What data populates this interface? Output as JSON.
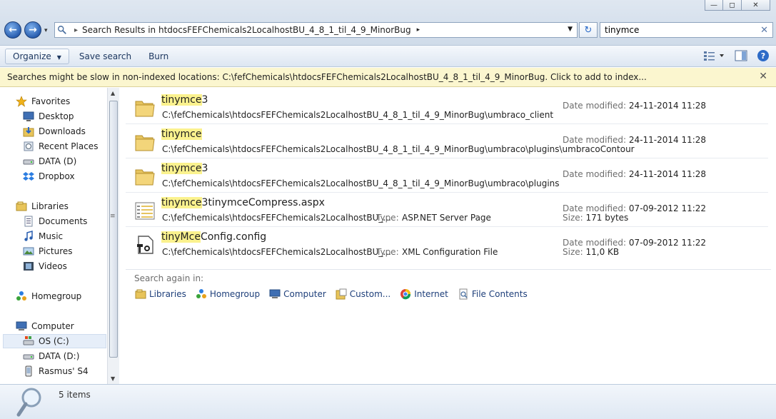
{
  "window": {
    "minimize": "—",
    "maximize": "◻",
    "close": "✕"
  },
  "nav": {
    "back": "←",
    "forward": "→",
    "dropdown": "▾"
  },
  "address": {
    "path_label": "Search Results in htdocsFEFChemicals2LocalhostBU_4_8_1_til_4_9_MinorBug"
  },
  "search": {
    "value": "tinymce",
    "clear": "✕"
  },
  "toolbar": {
    "organize": "Organize",
    "save_search": "Save search",
    "burn": "Burn"
  },
  "infobar": {
    "text": "Searches might be slow in non-indexed locations: C:\\fefChemicals\\htdocsFEFChemicals2LocalhostBU_4_8_1_til_4_9_MinorBug. Click to add to index...",
    "close": "✕"
  },
  "sidebar": {
    "items": [
      {
        "label": "Favorites",
        "icon": "star-icon"
      },
      {
        "label": "Desktop",
        "icon": "desktop-icon"
      },
      {
        "label": "Downloads",
        "icon": "downloads-icon"
      },
      {
        "label": "Recent Places",
        "icon": "recent-places-icon"
      },
      {
        "label": "DATA (D)",
        "icon": "drive-icon"
      },
      {
        "label": "Dropbox",
        "icon": "dropbox-icon"
      },
      {
        "label": "Libraries",
        "icon": "libraries-icon"
      },
      {
        "label": "Documents",
        "icon": "documents-icon"
      },
      {
        "label": "Music",
        "icon": "music-icon"
      },
      {
        "label": "Pictures",
        "icon": "pictures-icon"
      },
      {
        "label": "Videos",
        "icon": "videos-icon"
      },
      {
        "label": "Homegroup",
        "icon": "homegroup-icon"
      },
      {
        "label": "Computer",
        "icon": "computer-icon"
      },
      {
        "label": "OS (C:)",
        "icon": "os-drive-icon"
      },
      {
        "label": "DATA (D:)",
        "icon": "drive-icon"
      },
      {
        "label": "Rasmus' S4",
        "icon": "phone-icon"
      }
    ]
  },
  "results": [
    {
      "hl": "tinymce",
      "rest": "3",
      "path": "C:\\fefChemicals\\htdocsFEFChemicals2LocalhostBU_4_8_1_til_4_9_MinorBug\\umbraco_client",
      "type_label": "",
      "type_value": "",
      "m1_label": "Date modified:",
      "m1_value": "24-11-2014 11:28",
      "m2_label": "",
      "m2_value": "",
      "icon": "folder-icon"
    },
    {
      "hl": "tinymce",
      "rest": "",
      "path": "C:\\fefChemicals\\htdocsFEFChemicals2LocalhostBU_4_8_1_til_4_9_MinorBug\\umbraco\\plugins\\umbracoContour",
      "type_label": "",
      "type_value": "",
      "m1_label": "",
      "m1_value": "",
      "m2_label": "Date modified:",
      "m2_value": "24-11-2014 11:28",
      "icon": "folder-icon"
    },
    {
      "hl": "tinymce",
      "rest": "3",
      "path": "C:\\fefChemicals\\htdocsFEFChemicals2LocalhostBU_4_8_1_til_4_9_MinorBug\\umbraco\\plugins",
      "type_label": "",
      "type_value": "",
      "m1_label": "",
      "m1_value": "",
      "m2_label": "Date modified:",
      "m2_value": "24-11-2014 11:28",
      "icon": "folder-icon"
    },
    {
      "hl": "tinymce",
      "rest": "3tinymceCompress.aspx",
      "path": "C:\\fefChemicals\\htdocsFEFChemicals2LocalhostBU_...",
      "type_label": "Type:",
      "type_value": "ASP.NET Server Page",
      "m1_label": "Date modified:",
      "m1_value": "07-09-2012 11:22",
      "m2_label": "Size:",
      "m2_value": "171 bytes",
      "icon": "aspx-file-icon"
    },
    {
      "hl": "tinyMce",
      "rest": "Config.config",
      "path": "C:\\fefChemicals\\htdocsFEFChemicals2LocalhostBU_...",
      "type_label": "Type:",
      "type_value": "XML Configuration File",
      "m1_label": "Date modified:",
      "m1_value": "07-09-2012 11:22",
      "m2_label": "Size:",
      "m2_value": "11,0 KB",
      "icon": "config-file-icon"
    }
  ],
  "search_again": {
    "label": "Search again in:",
    "items": [
      {
        "label": "Libraries",
        "icon": "libraries-icon"
      },
      {
        "label": "Homegroup",
        "icon": "homegroup-icon"
      },
      {
        "label": "Computer",
        "icon": "computer-icon"
      },
      {
        "label": "Custom...",
        "icon": "custom-folder-icon"
      },
      {
        "label": "Internet",
        "icon": "internet-icon"
      },
      {
        "label": "File Contents",
        "icon": "file-contents-icon"
      }
    ]
  },
  "details": {
    "count": "5 items"
  },
  "colors": {
    "highlight": "#fbf28e",
    "infobar": "#fbf6cf",
    "link": "#1e3f7a"
  }
}
